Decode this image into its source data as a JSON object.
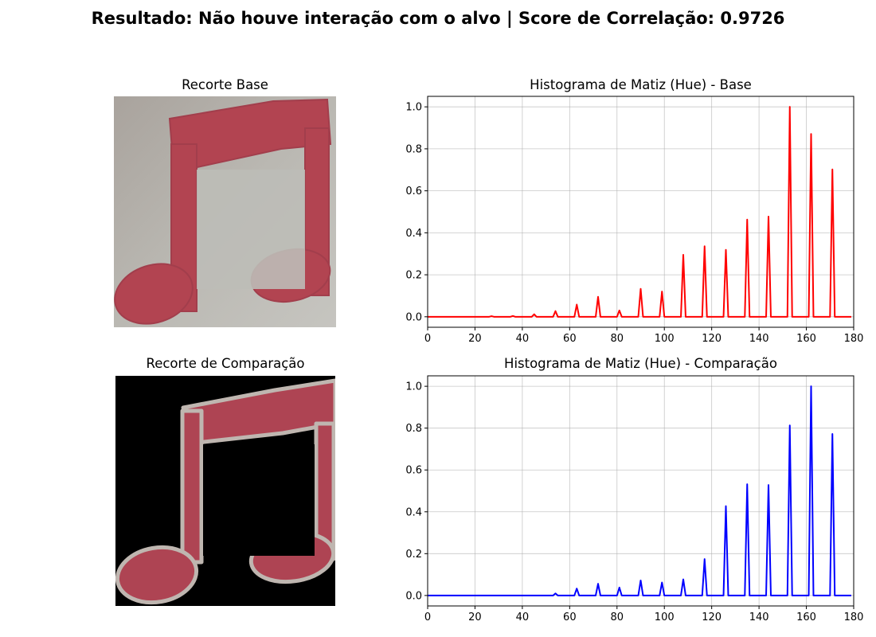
{
  "figure": {
    "suptitle": "Resultado: Não houve interação com o alvo | Score de Correlação: 0.9726"
  },
  "images": {
    "base": {
      "title": "Recorte Base",
      "background_color": "#b4b1ab",
      "glyph_color": "#b24451"
    },
    "comparison": {
      "title": "Recorte de Comparação",
      "background_color": "#000000",
      "glyph_color": "#b04553",
      "edge_color": "#bfb6b0"
    }
  },
  "chart_data": [
    {
      "type": "line",
      "title": "Histograma de Matiz (Hue) - Base",
      "xlabel": "",
      "ylabel": "",
      "xlim": [
        0,
        180
      ],
      "ylim": [
        -0.05,
        1.05
      ],
      "xticks": [
        "0",
        "20",
        "40",
        "60",
        "80",
        "100",
        "120",
        "140",
        "160",
        "180"
      ],
      "yticks": [
        "0.0",
        "0.2",
        "0.4",
        "0.6",
        "0.8",
        "1.0"
      ],
      "grid": true,
      "color": "#ff0000",
      "series": [
        {
          "x": [
            27,
            36,
            45,
            54,
            63,
            72,
            81,
            90,
            99,
            108,
            117,
            126,
            135,
            144,
            153,
            162,
            171
          ],
          "values": [
            0.003,
            0.004,
            0.012,
            0.027,
            0.058,
            0.095,
            0.03,
            0.133,
            0.12,
            0.295,
            0.336,
            0.319,
            0.463,
            0.477,
            1.0,
            0.871,
            0.702
          ]
        }
      ],
      "baseline": 0.0,
      "x_end": 179
    },
    {
      "type": "line",
      "title": "Histograma de Matiz (Hue) - Comparação",
      "xlabel": "",
      "ylabel": "",
      "xlim": [
        0,
        180
      ],
      "ylim": [
        -0.05,
        1.05
      ],
      "xticks": [
        "0",
        "20",
        "40",
        "60",
        "80",
        "100",
        "120",
        "140",
        "160",
        "180"
      ],
      "yticks": [
        "0.0",
        "0.2",
        "0.4",
        "0.6",
        "0.8",
        "1.0"
      ],
      "grid": true,
      "color": "#0000ff",
      "series": [
        {
          "x": [
            54,
            63,
            72,
            81,
            90,
            99,
            108,
            117,
            126,
            135,
            144,
            153,
            162,
            171
          ],
          "values": [
            0.01,
            0.033,
            0.056,
            0.038,
            0.072,
            0.062,
            0.077,
            0.174,
            0.427,
            0.532,
            0.528,
            0.813,
            1.0,
            0.772
          ]
        }
      ],
      "baseline": 0.0,
      "x_end": 179
    }
  ]
}
